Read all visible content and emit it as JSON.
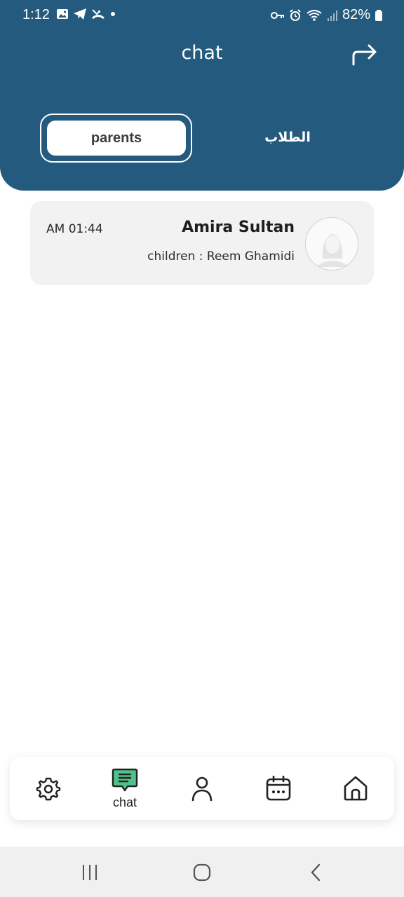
{
  "status_bar": {
    "time": "1:12",
    "battery": "82%",
    "left_icons": [
      "image-icon",
      "telegram-icon",
      "missed-call-icon",
      "dot-icon"
    ],
    "right_icons": [
      "key-icon",
      "alarm-icon",
      "wifi-icon",
      "signal-icon",
      "battery-icon"
    ]
  },
  "header": {
    "title": "chat",
    "share_icon": "share-arrow-icon",
    "background_color": "#235a7d"
  },
  "tabs": [
    {
      "label": "parents",
      "selected": true
    },
    {
      "label": "الطلاب",
      "selected": false
    }
  ],
  "chats": [
    {
      "time": "AM 01:44",
      "name": "Amira Sultan",
      "children": "children : Reem Ghamidi",
      "avatar_icon": "avatar-placeholder-icon"
    }
  ],
  "bottom_nav": {
    "items": [
      {
        "icon": "gear-icon",
        "label": ""
      },
      {
        "icon": "chat-icon",
        "label": "chat",
        "active": true,
        "active_color": "#4cc38a"
      },
      {
        "icon": "user-icon",
        "label": ""
      },
      {
        "icon": "calendar-icon",
        "label": ""
      },
      {
        "icon": "home-icon",
        "label": ""
      }
    ]
  },
  "system_nav": [
    "recent-apps-icon",
    "home-circle-icon",
    "back-icon"
  ]
}
